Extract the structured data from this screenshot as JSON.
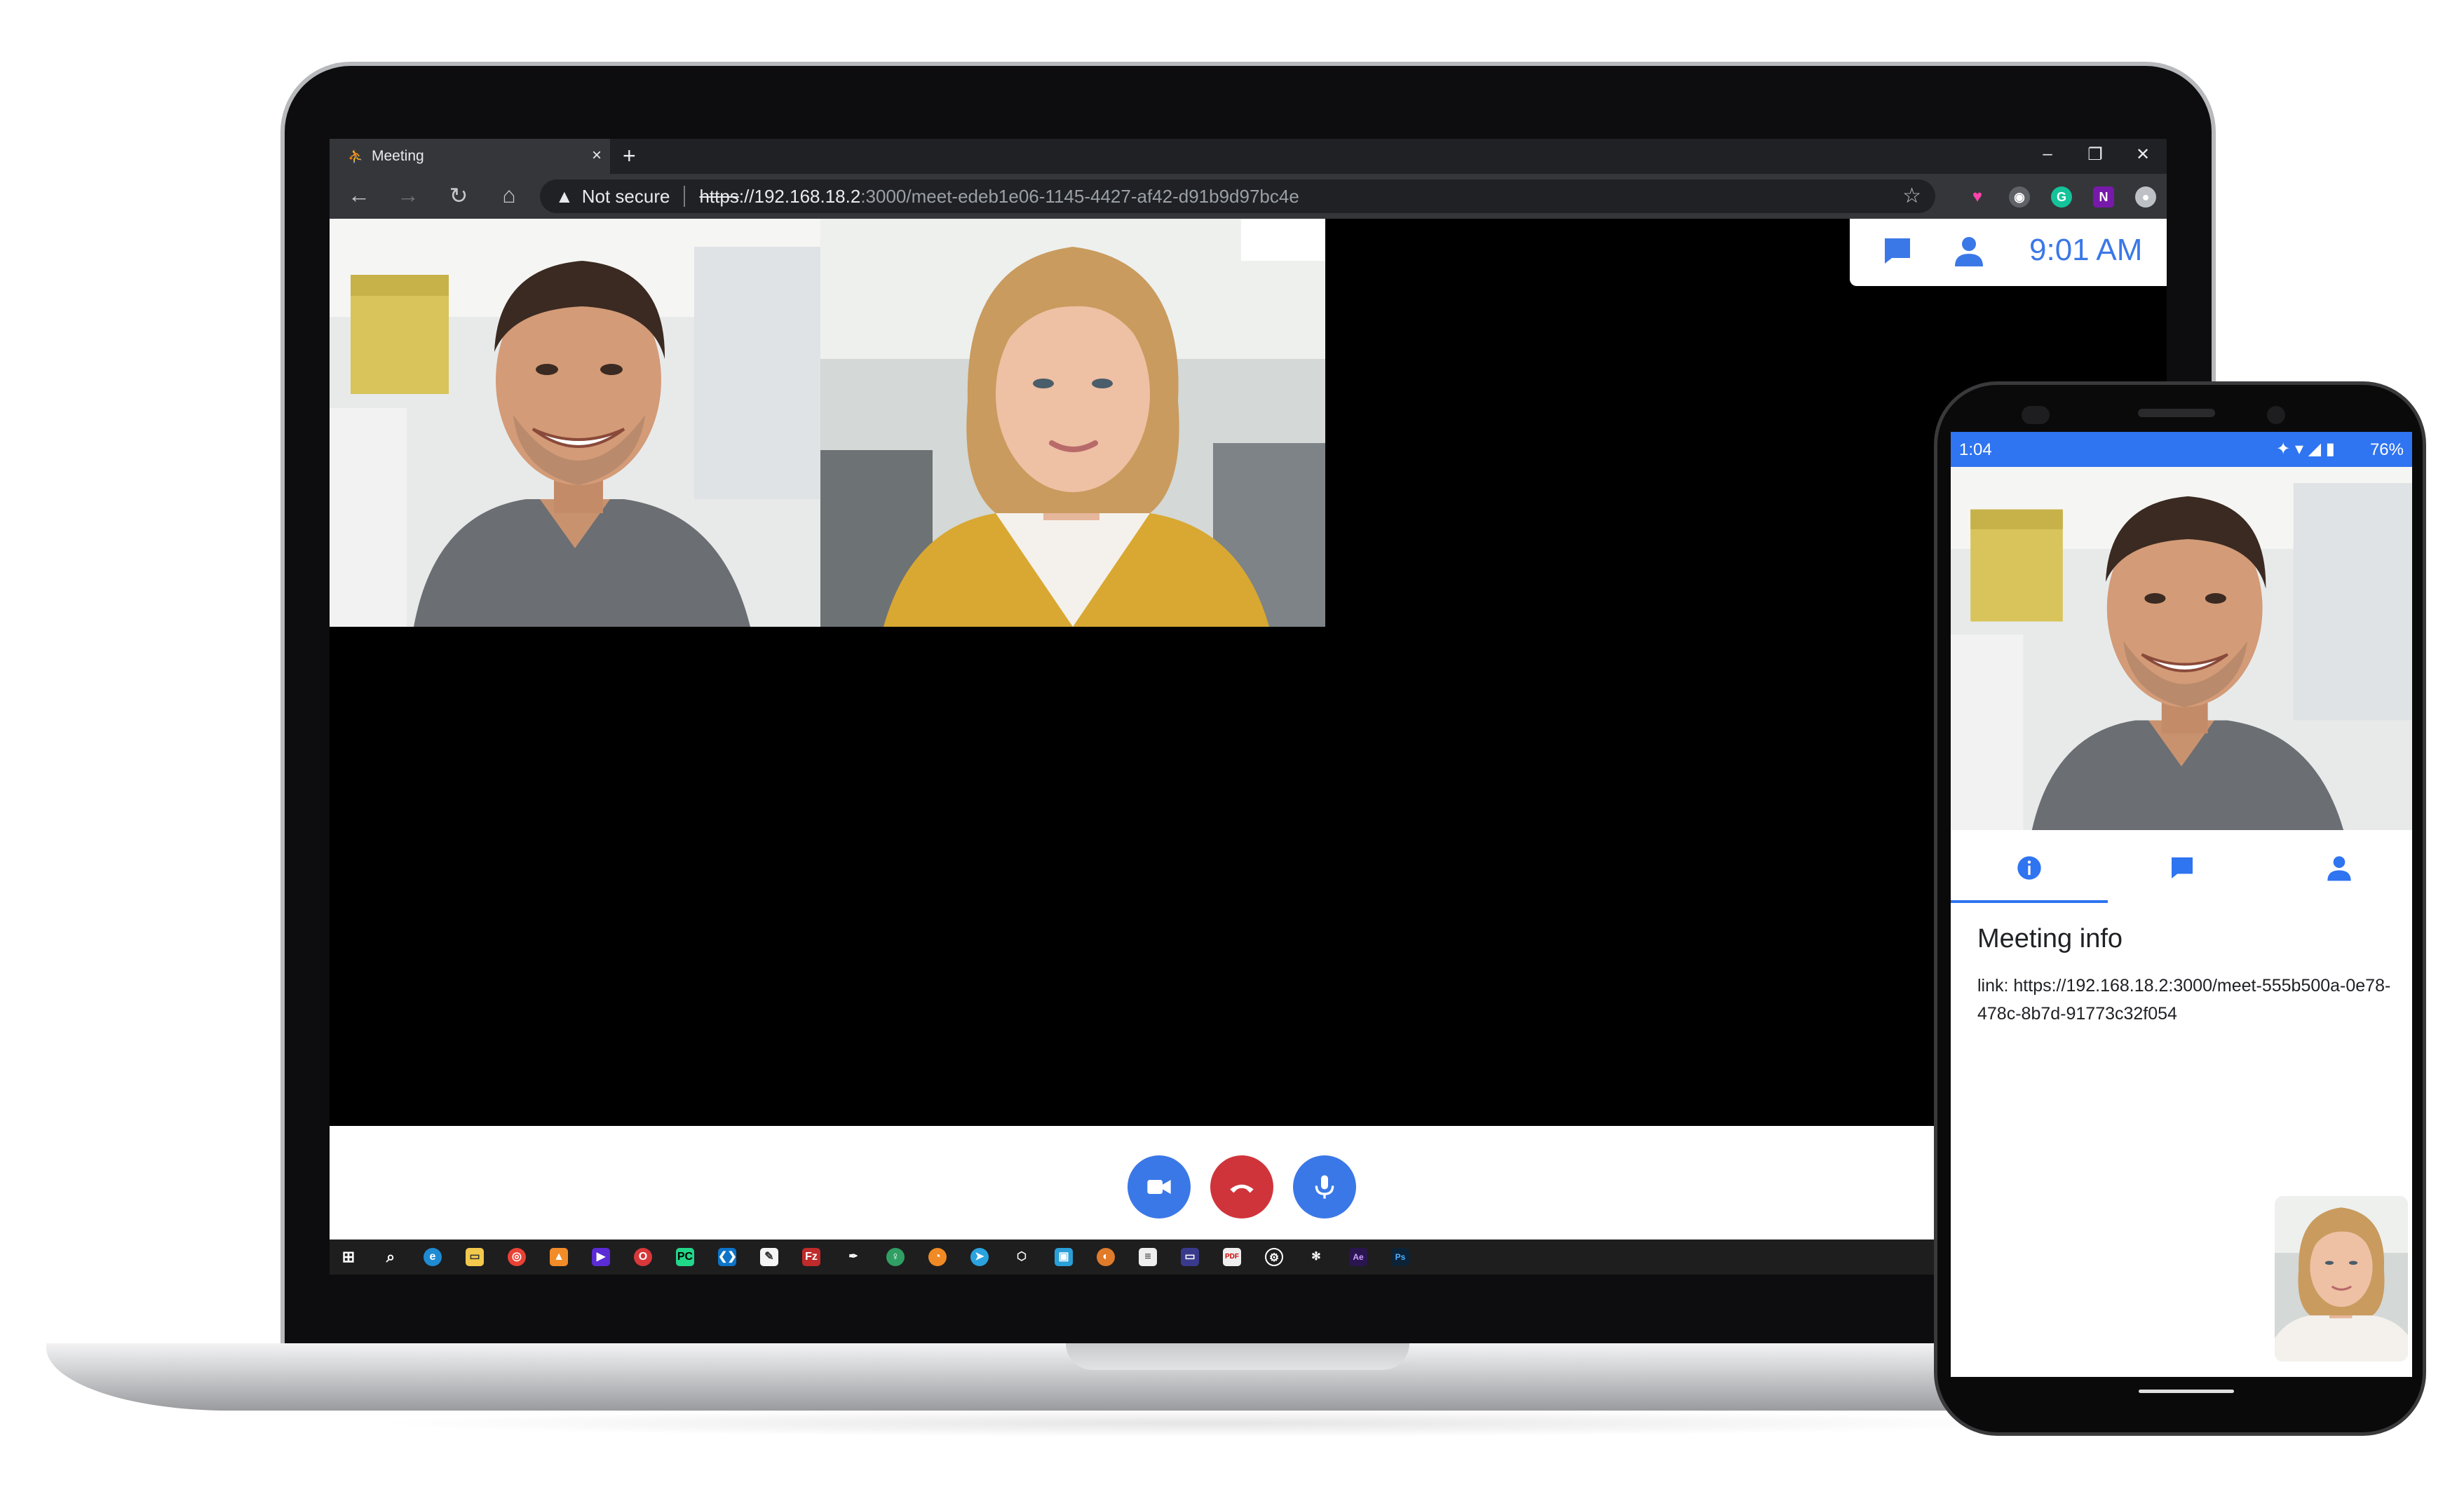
{
  "browser": {
    "tab_title": "Meeting",
    "tab_close": "×",
    "new_tab": "+",
    "window_controls": {
      "minimize": "–",
      "restore": "❐",
      "close": "✕"
    },
    "security_label": "Not secure",
    "url_scheme": "https",
    "url_host": "://192.168.18.2",
    "url_rest": ":3000/meet-edeb1e06-1145-4427-af42-d91b9d97bc4e",
    "nav_icons": [
      "back-icon",
      "forward-icon",
      "reload-icon",
      "home-icon"
    ],
    "extension_icons": [
      "heart-extension-icon",
      "camera-extension-icon",
      "grammarly-icon",
      "onenote-icon",
      "circle-extension-icon",
      "collections-icon",
      "profile-avatar-icon",
      "more-icon"
    ]
  },
  "meeting": {
    "clock": "9:01 AM",
    "participants": [
      "man-smiling",
      "woman-blonde"
    ],
    "controls": {
      "camera_color": "#3b78e7",
      "hangup_color": "#d0343b",
      "mic_color": "#3b78e7"
    }
  },
  "taskbar": {
    "icons": [
      "windows-start",
      "search",
      "edge",
      "file-explorer",
      "chrome",
      "vlc",
      "video-editor",
      "opera",
      "pycharm",
      "vscode",
      "notes",
      "filezilla",
      "inkscape",
      "gitkraken",
      "clock-app",
      "telegram",
      "cube-app",
      "photos",
      "blender",
      "notepad",
      "terminal",
      "pdf-reader",
      "settings",
      "puzzle-app",
      "after-effects",
      "photoshop"
    ]
  },
  "phone": {
    "time": "1:04",
    "battery": "76%",
    "tabs": [
      "info",
      "chat",
      "participants"
    ],
    "meeting_info_title": "Meeting info",
    "meeting_link": "link: https://192.168.18.2:3000/meet-555b500a-0e78-478c-8b7d-91773c32f054"
  },
  "colors": {
    "accent": "#3b78e7",
    "hangup": "#d0343b",
    "status_bar": "#2f74f0"
  }
}
